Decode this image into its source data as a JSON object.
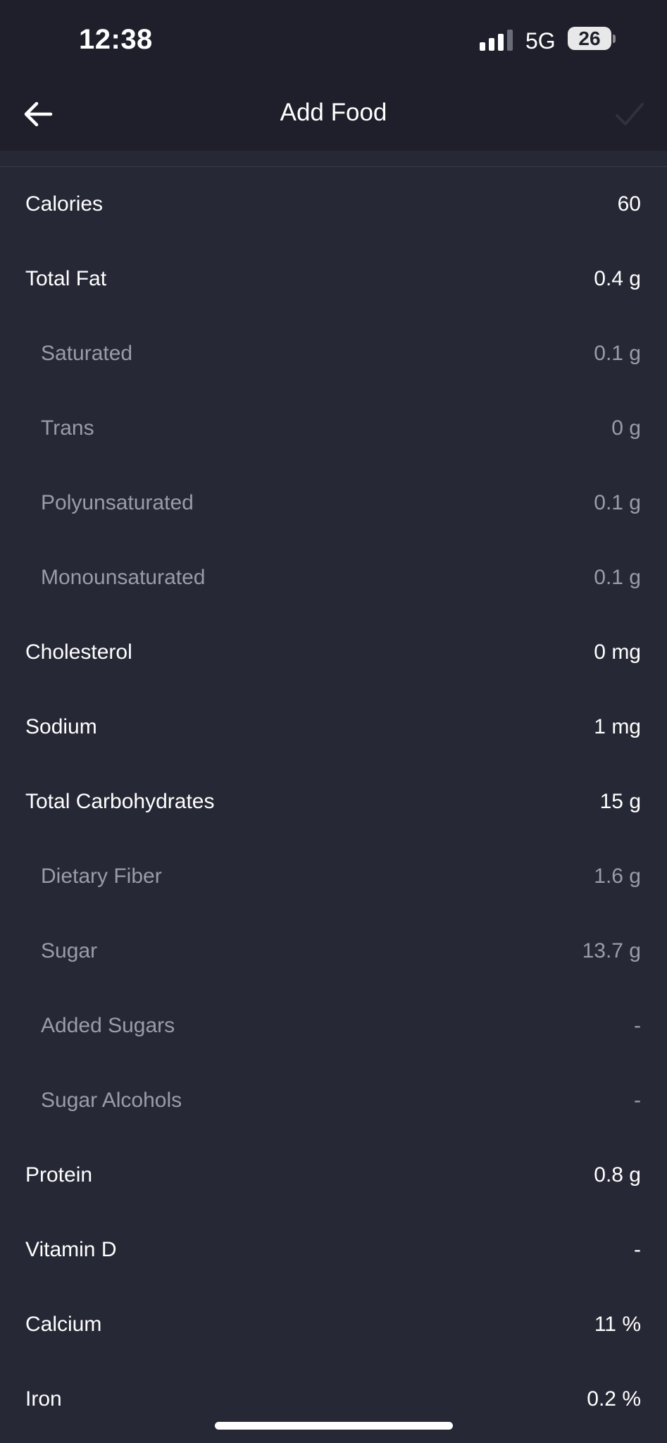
{
  "status_bar": {
    "time": "12:38",
    "network": "5G",
    "battery": "26"
  },
  "header": {
    "title": "Add Food",
    "back_icon": "arrow-left-icon",
    "confirm_icon": "checkmark-icon"
  },
  "nutrients": [
    {
      "label": "Calories",
      "value": "60",
      "sub": false
    },
    {
      "label": "Total Fat",
      "value": "0.4 g",
      "sub": false
    },
    {
      "label": "Saturated",
      "value": "0.1 g",
      "sub": true
    },
    {
      "label": "Trans",
      "value": "0 g",
      "sub": true
    },
    {
      "label": "Polyunsaturated",
      "value": "0.1 g",
      "sub": true
    },
    {
      "label": "Monounsaturated",
      "value": "0.1 g",
      "sub": true
    },
    {
      "label": "Cholesterol",
      "value": "0 mg",
      "sub": false
    },
    {
      "label": "Sodium",
      "value": "1 mg",
      "sub": false
    },
    {
      "label": "Total Carbohydrates",
      "value": "15 g",
      "sub": false
    },
    {
      "label": "Dietary Fiber",
      "value": "1.6 g",
      "sub": true
    },
    {
      "label": "Sugar",
      "value": "13.7 g",
      "sub": true
    },
    {
      "label": "Added Sugars",
      "value": "-",
      "sub": true
    },
    {
      "label": "Sugar Alcohols",
      "value": "-",
      "sub": true
    },
    {
      "label": "Protein",
      "value": "0.8 g",
      "sub": false
    },
    {
      "label": "Vitamin D",
      "value": "-",
      "sub": false
    },
    {
      "label": "Calcium",
      "value": "11 %",
      "sub": false
    },
    {
      "label": "Iron",
      "value": "0.2 %",
      "sub": false
    }
  ],
  "colors": {
    "background": "#262835",
    "header_background": "#1e1f2b",
    "primary_text": "#ffffff",
    "secondary_text": "#9a9ca8"
  }
}
